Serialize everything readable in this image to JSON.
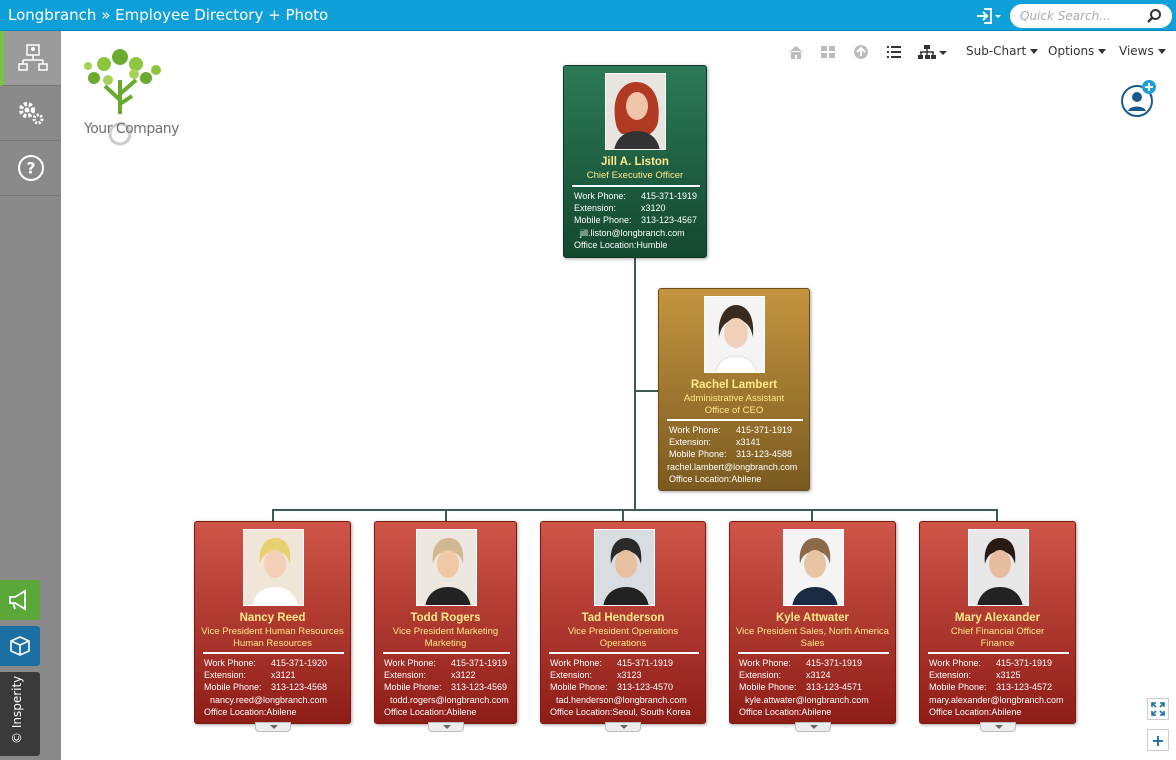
{
  "header": {
    "title": "Longbranch » Employee Directory + Photo",
    "search_placeholder": "Quick Search..."
  },
  "sidebar": {
    "items": [
      {
        "name": "org-chart",
        "icon": "org-chart-icon",
        "active": true
      },
      {
        "name": "settings",
        "icon": "gears-icon",
        "active": false
      },
      {
        "name": "help",
        "icon": "help-icon",
        "active": false
      }
    ],
    "bottom": [
      {
        "name": "announcements",
        "icon": "megaphone-icon",
        "color": "#5aa83a"
      },
      {
        "name": "package",
        "icon": "box-icon",
        "color": "#1c6fa3"
      }
    ],
    "brand_label": "© Insperity"
  },
  "logo": {
    "text": "Your Company"
  },
  "toolbar": {
    "subchart_label": "Sub-Chart",
    "options_label": "Options",
    "views_label": "Views"
  },
  "colors": {
    "topbar": "#0f9fd9",
    "ceo_card": "#1e5f43",
    "assistant_card": "#a57a30",
    "vp_card": "#b23a30",
    "name_text": "#ffe98a",
    "sidebar_active": "#7cc242"
  },
  "labels": {
    "work_phone": "Work Phone:",
    "extension": "Extension:",
    "mobile_phone": "Mobile Phone:",
    "office_location": "Office Location:"
  },
  "ceo": {
    "name": "Jill A. Liston",
    "title": "Chief Executive Officer",
    "work_phone": "415-371-1919",
    "extension": "x3120",
    "mobile_phone": "313-123-4567",
    "email": "jill.liston@longbranch.com",
    "office": "Humble"
  },
  "assistant": {
    "name": "Rachel Lambert",
    "title": "Administrative Assistant",
    "department": "Office of CEO",
    "work_phone": "415-371-1919",
    "extension": "x3141",
    "mobile_phone": "313-123-4588",
    "email": "rachel.lambert@longbranch.com",
    "office": "Abilene"
  },
  "reports": [
    {
      "name": "Nancy Reed",
      "title": "Vice President Human Resources",
      "department": "Human Resources",
      "work_phone": "415-371-1920",
      "extension": "x3121",
      "mobile_phone": "313-123-4568",
      "email": "nancy.reed@longbranch.com",
      "office": "Abilene"
    },
    {
      "name": "Todd Rogers",
      "title": "Vice President Marketing",
      "department": "Marketing",
      "work_phone": "415-371-1919",
      "extension": "x3122",
      "mobile_phone": "313-123-4569",
      "email": "todd.rogers@longbranch.com",
      "office": "Abilene"
    },
    {
      "name": "Tad Henderson",
      "title": "Vice President Operations",
      "department": "Operations",
      "work_phone": "415-371-1919",
      "extension": "x3123",
      "mobile_phone": "313-123-4570",
      "email": "tad.henderson@longbranch.com",
      "office": "Seoul, South Korea"
    },
    {
      "name": "Kyle Attwater",
      "title": "Vice President Sales, North America",
      "department": "Sales",
      "work_phone": "415-371-1919",
      "extension": "x3124",
      "mobile_phone": "313-123-4571",
      "email": "kyle.attwater@longbranch.com",
      "office": "Abilene"
    },
    {
      "name": "Mary Alexander",
      "title": "Chief Financial Officer",
      "department": "Finance",
      "work_phone": "415-371-1919",
      "extension": "x3125",
      "mobile_phone": "313-123-4572",
      "email": "mary.alexander@longbranch.com",
      "office": "Abilene"
    }
  ]
}
